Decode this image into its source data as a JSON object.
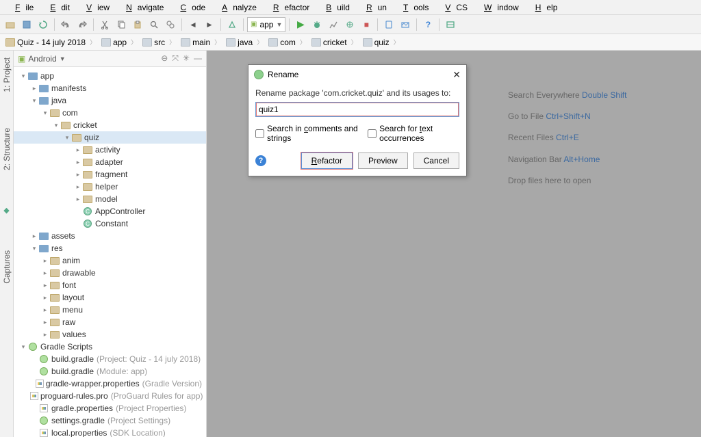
{
  "menu": [
    "File",
    "Edit",
    "View",
    "Navigate",
    "Code",
    "Analyze",
    "Refactor",
    "Build",
    "Run",
    "Tools",
    "VCS",
    "Window",
    "Help"
  ],
  "run_config": "app",
  "breadcrumb": [
    {
      "label": "Quiz - 14 july 2018",
      "type": "brown"
    },
    {
      "label": "app",
      "type": "blue"
    },
    {
      "label": "src",
      "type": "blue"
    },
    {
      "label": "main",
      "type": "blue"
    },
    {
      "label": "java",
      "type": "blue"
    },
    {
      "label": "com",
      "type": "blue"
    },
    {
      "label": "cricket",
      "type": "blue"
    },
    {
      "label": "quiz",
      "type": "blue"
    }
  ],
  "gutter": {
    "project": "1: Project",
    "structure": "2: Structure",
    "captures": "Captures"
  },
  "tree_header": "Android",
  "tree": [
    {
      "d": 0,
      "a": "v",
      "i": "blue",
      "t": "app"
    },
    {
      "d": 1,
      "a": ">",
      "i": "blue",
      "t": "manifests"
    },
    {
      "d": 1,
      "a": "v",
      "i": "blue",
      "t": "java"
    },
    {
      "d": 2,
      "a": "v",
      "i": "tan",
      "t": "com"
    },
    {
      "d": 3,
      "a": "v",
      "i": "tan",
      "t": "cricket"
    },
    {
      "d": 4,
      "a": "v",
      "i": "tan",
      "t": "quiz",
      "sel": true
    },
    {
      "d": 5,
      "a": ">",
      "i": "tan",
      "t": "activity"
    },
    {
      "d": 5,
      "a": ">",
      "i": "tan",
      "t": "adapter"
    },
    {
      "d": 5,
      "a": ">",
      "i": "tan",
      "t": "fragment"
    },
    {
      "d": 5,
      "a": ">",
      "i": "tan",
      "t": "helper"
    },
    {
      "d": 5,
      "a": ">",
      "i": "tan",
      "t": "model"
    },
    {
      "d": 5,
      "a": "",
      "i": "class",
      "t": "AppController"
    },
    {
      "d": 5,
      "a": "",
      "i": "class",
      "t": "Constant"
    },
    {
      "d": 1,
      "a": ">",
      "i": "blue",
      "t": "assets"
    },
    {
      "d": 1,
      "a": "v",
      "i": "blue",
      "t": "res"
    },
    {
      "d": 2,
      "a": ">",
      "i": "tan",
      "t": "anim"
    },
    {
      "d": 2,
      "a": ">",
      "i": "tan",
      "t": "drawable"
    },
    {
      "d": 2,
      "a": ">",
      "i": "tan",
      "t": "font"
    },
    {
      "d": 2,
      "a": ">",
      "i": "tan",
      "t": "layout"
    },
    {
      "d": 2,
      "a": ">",
      "i": "tan",
      "t": "menu"
    },
    {
      "d": 2,
      "a": ">",
      "i": "tan",
      "t": "raw"
    },
    {
      "d": 2,
      "a": ">",
      "i": "tan",
      "t": "values"
    },
    {
      "d": 0,
      "a": "v",
      "i": "gradle",
      "t": "Gradle Scripts"
    },
    {
      "d": 1,
      "a": "",
      "i": "gradle",
      "t": "build.gradle",
      "s": "(Project: Quiz - 14 july 2018)"
    },
    {
      "d": 1,
      "a": "",
      "i": "gradle",
      "t": "build.gradle",
      "s": "(Module: app)"
    },
    {
      "d": 1,
      "a": "",
      "i": "prop",
      "t": "gradle-wrapper.properties",
      "s": "(Gradle Version)"
    },
    {
      "d": 1,
      "a": "",
      "i": "prop",
      "t": "proguard-rules.pro",
      "s": "(ProGuard Rules for app)"
    },
    {
      "d": 1,
      "a": "",
      "i": "prop",
      "t": "gradle.properties",
      "s": "(Project Properties)"
    },
    {
      "d": 1,
      "a": "",
      "i": "gradle",
      "t": "settings.gradle",
      "s": "(Project Settings)"
    },
    {
      "d": 1,
      "a": "",
      "i": "prop",
      "t": "local.properties",
      "s": "(SDK Location)"
    }
  ],
  "hints": [
    {
      "l": "Search Everywhere ",
      "k": "Double Shift"
    },
    {
      "l": "Go to File ",
      "k": "Ctrl+Shift+N"
    },
    {
      "l": "Recent Files ",
      "k": "Ctrl+E"
    },
    {
      "l": "Navigation Bar ",
      "k": "Alt+Home"
    },
    {
      "l": "Drop files here to open",
      "k": ""
    }
  ],
  "dialog": {
    "title": "Rename",
    "message": "Rename package 'com.cricket.quiz' and its usages to:",
    "value": "quiz1",
    "check1": "Search in comments and strings",
    "check2": "Search for text occurrences",
    "btn_refactor": "Refactor",
    "btn_preview": "Preview",
    "btn_cancel": "Cancel"
  }
}
